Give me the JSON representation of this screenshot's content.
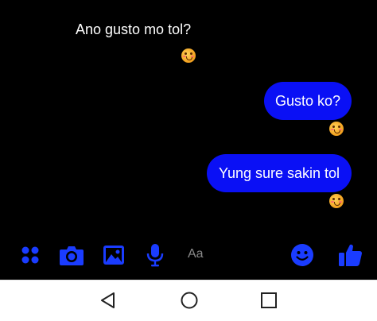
{
  "messages": {
    "incoming": [
      {
        "text": "Ano gusto mo tol?",
        "reaction": "blushing-face-emoji"
      }
    ],
    "outgoing": [
      {
        "text": "Gusto ko?",
        "reaction": "blushing-face-emoji"
      },
      {
        "text": "Yung sure sakin tol",
        "reaction": "blushing-face-emoji"
      }
    ]
  },
  "composer": {
    "placeholder": "Aa",
    "icons": [
      "apps-grid-icon",
      "camera-icon",
      "gallery-icon",
      "microphone-icon",
      "emoji-icon",
      "thumbs-up-icon"
    ]
  },
  "navbar": {
    "icons": [
      "back-triangle-icon",
      "home-circle-icon",
      "recents-square-icon"
    ]
  },
  "colors": {
    "background": "#000000",
    "bubble": "#0a10f5",
    "accent_icon": "#1a3cff",
    "text": "#ffffff",
    "placeholder": "#8a8a8a",
    "navbar_bg": "#ffffff"
  }
}
